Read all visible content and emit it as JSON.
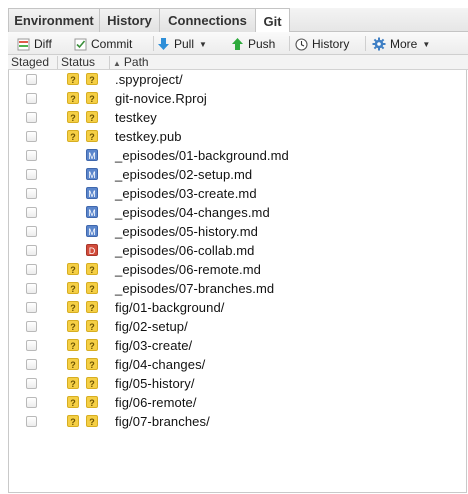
{
  "tabs": [
    "Environment",
    "History",
    "Connections",
    "Git"
  ],
  "active_tab": "Git",
  "toolbar": {
    "diff": "Diff",
    "commit": "Commit",
    "pull": "Pull",
    "push": "Push",
    "history": "History",
    "more": "More"
  },
  "columns": {
    "staged": "Staged",
    "status": "Status",
    "path": "Path"
  },
  "rows": [
    {
      "path": ".spyproject/",
      "status": [
        "?",
        "?"
      ]
    },
    {
      "path": "git-novice.Rproj",
      "status": [
        "?",
        "?"
      ]
    },
    {
      "path": "testkey",
      "status": [
        "?",
        "?"
      ]
    },
    {
      "path": "testkey.pub",
      "status": [
        "?",
        "?"
      ]
    },
    {
      "path": "_episodes/01-background.md",
      "status": [
        "",
        "M"
      ]
    },
    {
      "path": "_episodes/02-setup.md",
      "status": [
        "",
        "M"
      ]
    },
    {
      "path": "_episodes/03-create.md",
      "status": [
        "",
        "M"
      ]
    },
    {
      "path": "_episodes/04-changes.md",
      "status": [
        "",
        "M"
      ]
    },
    {
      "path": "_episodes/05-history.md",
      "status": [
        "",
        "M"
      ]
    },
    {
      "path": "_episodes/06-collab.md",
      "status": [
        "",
        "D"
      ]
    },
    {
      "path": "_episodes/06-remote.md",
      "status": [
        "?",
        "?"
      ]
    },
    {
      "path": "_episodes/07-branches.md",
      "status": [
        "?",
        "?"
      ]
    },
    {
      "path": "fig/01-background/",
      "status": [
        "?",
        "?"
      ]
    },
    {
      "path": "fig/02-setup/",
      "status": [
        "?",
        "?"
      ]
    },
    {
      "path": "fig/03-create/",
      "status": [
        "?",
        "?"
      ]
    },
    {
      "path": "fig/04-changes/",
      "status": [
        "?",
        "?"
      ]
    },
    {
      "path": "fig/05-history/",
      "status": [
        "?",
        "?"
      ]
    },
    {
      "path": "fig/06-remote/",
      "status": [
        "?",
        "?"
      ]
    },
    {
      "path": "fig/07-branches/",
      "status": [
        "?",
        "?"
      ]
    }
  ],
  "colors": {
    "untracked": "#f5cf45",
    "modified": "#5b86cc",
    "deleted": "#d24c3b",
    "push_arrow": "#2eaa3c",
    "pull_arrow": "#2f8fd8"
  }
}
